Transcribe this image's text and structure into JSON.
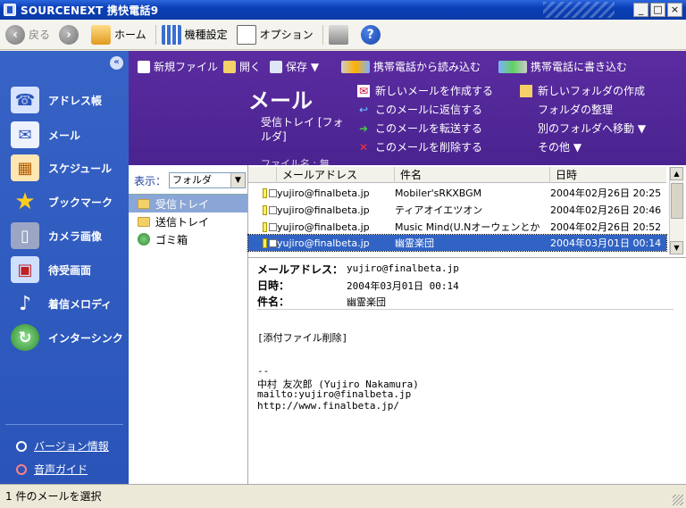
{
  "window": {
    "title": "SOURCENEXT 携快電話9"
  },
  "toolbar": {
    "back": "戻る",
    "home": "ホーム",
    "model_settings": "機種設定",
    "option": "オプション"
  },
  "nav": {
    "items": [
      {
        "label": "アドレス帳"
      },
      {
        "label": "メール"
      },
      {
        "label": "スケジュール"
      },
      {
        "label": "ブックマーク"
      },
      {
        "label": "カメラ画像"
      },
      {
        "label": "待受画面"
      },
      {
        "label": "着信メロディ"
      },
      {
        "label": "インターシンク"
      }
    ],
    "version_info": "バージョン情報",
    "voice_guide": "音声ガイド"
  },
  "header": {
    "new_file": "新規ファイル",
    "open": "開く",
    "save": "保存 ▼",
    "read_from_phone": "携帯電話から読み込む",
    "write_to_phone": "携帯電話に書き込む",
    "title": "メール",
    "folder_name": "受信トレイ [フォルダ]",
    "file_name": "ファイル名 : 無",
    "actions": {
      "create_mail": "新しいメールを作成する",
      "reply": "このメールに返信する",
      "forward": "このメールを転送する",
      "delete": "このメールを削除する",
      "new_folder": "新しいフォルダの作成",
      "organize_folders": "フォルダの整理",
      "move_to_folder": "別のフォルダへ移動 ▼",
      "others": "その他 ▼"
    }
  },
  "folders": {
    "view_label": "表示：",
    "view_value": "フォルダ",
    "items": [
      {
        "label": "受信トレイ"
      },
      {
        "label": "送信トレイ"
      },
      {
        "label": "ゴミ箱"
      }
    ]
  },
  "message_list": {
    "columns": [
      "メールアドレス",
      "件名",
      "日時"
    ],
    "rows": [
      {
        "address": "yujiro@finalbeta.jp",
        "subject": "Mobiler'sRKXBGM",
        "date": "2004年02月26日 20:25"
      },
      {
        "address": "yujiro@finalbeta.jp",
        "subject": "ティアオイエツオン",
        "date": "2004年02月26日 20:46"
      },
      {
        "address": "yujiro@finalbeta.jp",
        "subject": "Music Mind(U.Nオーウェンとか",
        "date": "2004年02月26日 20:52"
      },
      {
        "address": "yujiro@finalbeta.jp",
        "subject": "幽霊楽団",
        "date": "2004年03月01日 00:14"
      }
    ]
  },
  "preview": {
    "address_label": "メールアドレス：",
    "address_value": "yujiro@finalbeta.jp",
    "date_label": "日時：",
    "date_value": "2004年03月01日 00:14",
    "subject_label": "件名：",
    "subject_value": "幽霊楽団",
    "body": {
      "attachment": "[添付ファイル削除]",
      "sig_dash": "--",
      "sig_name": "中村 友次郎 (Yujiro Nakamura)",
      "sig_mail": "mailto:yujiro@finalbeta.jp",
      "sig_url": "http://www.finalbeta.jp/"
    }
  },
  "status": {
    "text": "1 件のメールを選択"
  }
}
